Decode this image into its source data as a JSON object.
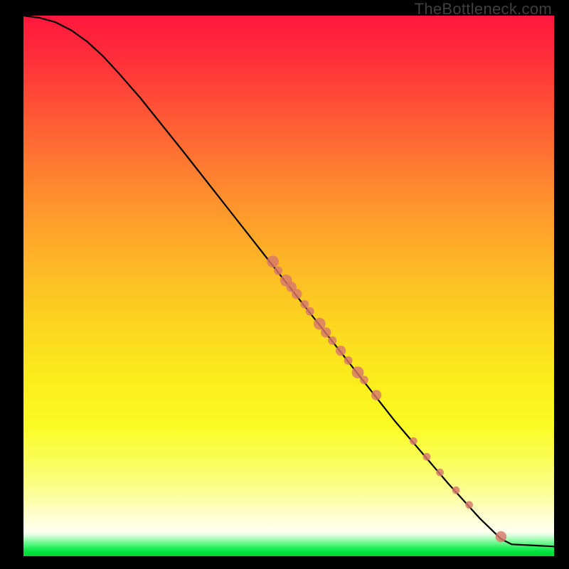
{
  "watermark": "TheBottleneck.com",
  "colors": {
    "page_bg": "#000000",
    "curve_stroke": "#000000",
    "point_fill": "#d8776b",
    "watermark_text": "#413f40"
  },
  "chart_data": {
    "type": "line",
    "title": "",
    "xlabel": "",
    "ylabel": "",
    "xlim": [
      0,
      100
    ],
    "ylim": [
      0,
      100
    ],
    "grid": false,
    "legend": false,
    "note": "No axis ticks or numeric labels are rendered in the image; x/y here are normalized 0–100 read off the plot area.",
    "curve": [
      {
        "x": 0.0,
        "y": 100.0
      },
      {
        "x": 3.0,
        "y": 99.6
      },
      {
        "x": 6.0,
        "y": 98.8
      },
      {
        "x": 9.0,
        "y": 97.3
      },
      {
        "x": 12.0,
        "y": 95.2
      },
      {
        "x": 15.0,
        "y": 92.5
      },
      {
        "x": 18.0,
        "y": 89.3
      },
      {
        "x": 22.0,
        "y": 84.8
      },
      {
        "x": 30.0,
        "y": 75.0
      },
      {
        "x": 40.0,
        "y": 62.5
      },
      {
        "x": 50.0,
        "y": 50.0
      },
      {
        "x": 60.0,
        "y": 37.5
      },
      {
        "x": 70.0,
        "y": 25.0
      },
      {
        "x": 80.0,
        "y": 13.5
      },
      {
        "x": 86.0,
        "y": 7.0
      },
      {
        "x": 90.0,
        "y": 3.2
      },
      {
        "x": 92.0,
        "y": 2.2
      },
      {
        "x": 100.0,
        "y": 1.8
      }
    ],
    "series": [
      {
        "name": "points",
        "points": [
          {
            "x": 47.0,
            "y": 54.5,
            "r": 1.4
          },
          {
            "x": 48.0,
            "y": 52.8,
            "r": 1.0
          },
          {
            "x": 49.5,
            "y": 51.0,
            "r": 1.4
          },
          {
            "x": 50.5,
            "y": 49.8,
            "r": 1.2
          },
          {
            "x": 51.5,
            "y": 48.5,
            "r": 1.2
          },
          {
            "x": 53.0,
            "y": 46.6,
            "r": 1.0
          },
          {
            "x": 54.0,
            "y": 45.3,
            "r": 1.0
          },
          {
            "x": 55.8,
            "y": 43.0,
            "r": 1.4
          },
          {
            "x": 57.0,
            "y": 41.4,
            "r": 1.2
          },
          {
            "x": 58.2,
            "y": 39.9,
            "r": 1.0
          },
          {
            "x": 59.8,
            "y": 38.0,
            "r": 1.2
          },
          {
            "x": 61.2,
            "y": 36.2,
            "r": 1.0
          },
          {
            "x": 63.0,
            "y": 34.0,
            "r": 1.4
          },
          {
            "x": 64.2,
            "y": 32.6,
            "r": 1.0
          },
          {
            "x": 66.5,
            "y": 29.8,
            "r": 1.2
          },
          {
            "x": 73.5,
            "y": 21.3,
            "r": 0.9
          },
          {
            "x": 76.0,
            "y": 18.4,
            "r": 0.9
          },
          {
            "x": 78.5,
            "y": 15.5,
            "r": 0.9
          },
          {
            "x": 81.5,
            "y": 12.2,
            "r": 0.9
          },
          {
            "x": 84.0,
            "y": 9.5,
            "r": 0.9
          },
          {
            "x": 90.0,
            "y": 3.6,
            "r": 1.3
          }
        ]
      }
    ]
  }
}
